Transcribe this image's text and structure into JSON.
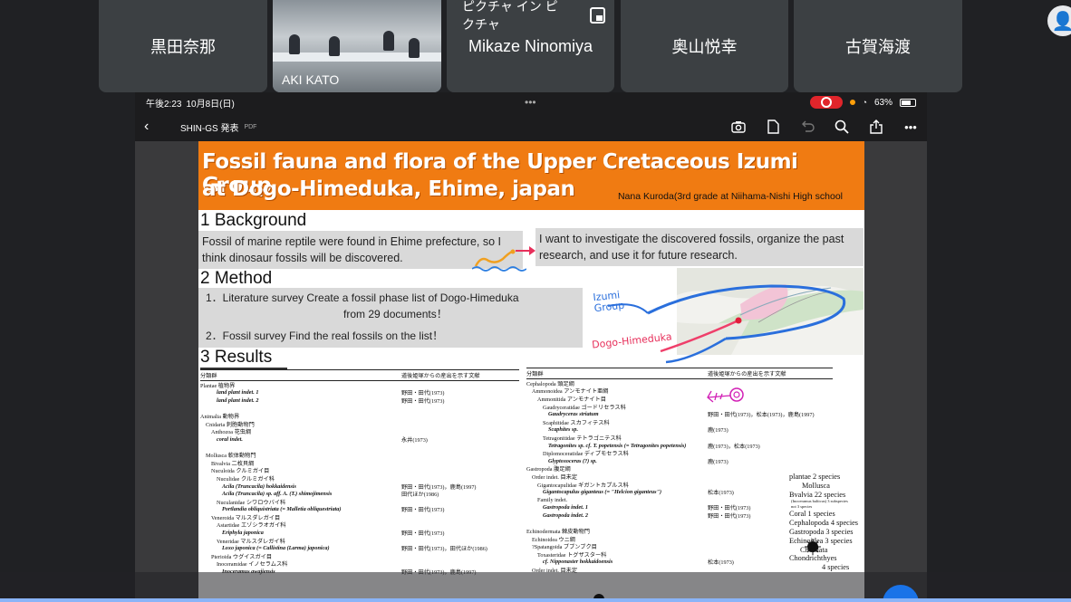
{
  "participants": [
    {
      "name": "黒田奈那"
    },
    {
      "name": "AKI KATO"
    },
    {
      "name": "Mikaze Ninomiya"
    },
    {
      "name": "奥山悦幸"
    },
    {
      "name": "古賀海渡"
    }
  ],
  "pip_label": "ピクチャ イン ピクチャ",
  "ipad": {
    "time": "午後2:23",
    "date": "10月8日(日)",
    "battery": "63%",
    "doc_title": "SHIN-GS 発表",
    "doc_type": "PDF"
  },
  "poster": {
    "title_line1": "Fossil fauna and flora of the Upper Cretaceous  Izumi Group",
    "title_line2": "at Dogo-Himeduka, Ehime, japan",
    "author": "Nana Kuroda(3rd grade at Niihama-Nishi High school",
    "background_title": "1  Background",
    "background_text1": "Fossil of  marine reptile were found  in Ehime prefecture, so I  think dinosaur fossils will be discovered.",
    "background_text2": "I want to investigate the discovered fossils, organize the past research, and use  it for future research.",
    "method_title": "2  Method",
    "method_step1a": "1．Literature survey      Create a fossil phase list of Dogo-Himeduka",
    "method_step1b": "from 29 documents！",
    "method_step2": "2．Fossil survey    Find  the real fossils  on the list！",
    "map_label_izumi": "Izumi Group",
    "map_label_dogo": "Dogo-Himeduka",
    "results_title": "3 Results",
    "table_header_col1": "分類群",
    "table_header_col2": "道後姫塚からの産出を示す文献",
    "left_table": [
      {
        "name": "Plantae  植物界",
        "ref": "",
        "b": false,
        "indent": 0
      },
      {
        "name": "land plant indet. 1",
        "ref": "野田・田代(1973)",
        "b": true,
        "indent": 3
      },
      {
        "name": "land plant indet. 2",
        "ref": "野田・田代(1973)",
        "b": true,
        "indent": 3
      },
      {
        "name": "",
        "ref": "",
        "b": false,
        "indent": 0
      },
      {
        "name": "Animalia  動物界",
        "ref": "",
        "b": false,
        "indent": 0
      },
      {
        "name": "Cnidaria  刺胞動物門",
        "ref": "",
        "b": false,
        "indent": 1
      },
      {
        "name": "Anthozoa  花虫綱",
        "ref": "",
        "b": false,
        "indent": 2
      },
      {
        "name": "coral indet.",
        "ref": "永井(1973)",
        "b": true,
        "indent": 3
      },
      {
        "name": "",
        "ref": "",
        "b": false,
        "indent": 0
      },
      {
        "name": "Mollusca  軟体動物門",
        "ref": "",
        "b": false,
        "indent": 1
      },
      {
        "name": "Bivalvia  二枚貝綱",
        "ref": "",
        "b": false,
        "indent": 2
      },
      {
        "name": "Nuculoida  クルミガイ目",
        "ref": "",
        "b": false,
        "indent": 2
      },
      {
        "name": "Nuculidae  クルミガイ科",
        "ref": "",
        "b": false,
        "indent": 3
      },
      {
        "name": "Acila (Truncacila) hokkaidensis",
        "ref": "野田・田代(1973)，鹿島(1997)",
        "b": true,
        "indent": 4
      },
      {
        "name": "Acila (Truncacila) sp. aff. A. (T.) shimojimensis",
        "ref": "田代ほか(1986)",
        "b": true,
        "indent": 4
      },
      {
        "name": "Nuculanidae  シワロウバイ科",
        "ref": "",
        "b": false,
        "indent": 3
      },
      {
        "name": "Portlandia obliquistriata (= Malletia obliquestriata)",
        "ref": "野田・田代(1973)",
        "b": true,
        "indent": 4
      },
      {
        "name": "Veneroida  マルスダレガイ目",
        "ref": "",
        "b": false,
        "indent": 2
      },
      {
        "name": "Astartidae  エゾシラオガイ科",
        "ref": "",
        "b": false,
        "indent": 3
      },
      {
        "name": "Eriphyla japonica",
        "ref": "野田・田代(1973)",
        "b": true,
        "indent": 4
      },
      {
        "name": "Veneridae  マルスダレガイ科",
        "ref": "",
        "b": false,
        "indent": 3
      },
      {
        "name": "Loxo japonica (= Callistina (Larma) japonica)",
        "ref": "野田・田代(1973)，田代ほか(1986)",
        "b": true,
        "indent": 4
      },
      {
        "name": "Pterioida  ウグイスガイ目",
        "ref": "",
        "b": false,
        "indent": 2
      },
      {
        "name": "Inoceramidae  イノセラムス科",
        "ref": "",
        "b": false,
        "indent": 3
      },
      {
        "name": "Inoceramus awajiensis",
        "ref": "野田・田代(1973)，鹿島(1997)",
        "b": true,
        "indent": 4
      }
    ],
    "right_table": [
      {
        "name": "Cephalopoda  頭足綱",
        "ref": "",
        "b": false,
        "indent": 0
      },
      {
        "name": "Ammonoidea  アンモナイト亜綱",
        "ref": "",
        "b": false,
        "indent": 1
      },
      {
        "name": "Ammonitida  アンモナイト目",
        "ref": "",
        "b": false,
        "indent": 2
      },
      {
        "name": "Gaudryceratidae  ゴードリセラス科",
        "ref": "",
        "b": false,
        "indent": 3
      },
      {
        "name": "Gaudryceras striatum",
        "ref": "野田・田代(1973)，松本(1973)，鹿島(1997)",
        "b": true,
        "indent": 4
      },
      {
        "name": "Scaphitidae  スカフィテス科",
        "ref": "",
        "b": false,
        "indent": 3
      },
      {
        "name": "Scaphites sp.",
        "ref": "鹿(1973)",
        "b": true,
        "indent": 4
      },
      {
        "name": "Tetragonitidae  テトラゴニテス科",
        "ref": "",
        "b": false,
        "indent": 3
      },
      {
        "name": "Tetragonites sp. cf. T. popetensis (= Tetragonites popetensis)",
        "ref": "鹿(1973)，松本(1973)",
        "b": true,
        "indent": 4
      },
      {
        "name": "Diplomoceratidae  ディプモセラス科",
        "ref": "",
        "b": false,
        "indent": 3
      },
      {
        "name": "Glyptoxoceras (?) sp.",
        "ref": "鹿(1973)",
        "b": true,
        "indent": 4
      },
      {
        "name": "Gastropoda  腹足綱",
        "ref": "",
        "b": false,
        "indent": 0
      },
      {
        "name": "Order indet.  目未定",
        "ref": "",
        "b": false,
        "indent": 1
      },
      {
        "name": "Gigantocapulidae  ギガントカプルス科",
        "ref": "",
        "b": false,
        "indent": 2
      },
      {
        "name": "Gigantocapulus giganteus (= \"Helcion giganteus\")",
        "ref": "松本(1973)",
        "b": true,
        "indent": 3
      },
      {
        "name": "Family indet.",
        "ref": "",
        "b": false,
        "indent": 2
      },
      {
        "name": "Gastropoda indet. 1",
        "ref": "野田・田代(1973)",
        "b": true,
        "indent": 3
      },
      {
        "name": "Gastropoda indet. 2",
        "ref": "野田・田代(1973)",
        "b": true,
        "indent": 3
      },
      {
        "name": "",
        "ref": "",
        "b": false,
        "indent": 0
      },
      {
        "name": "Echinodermata  棘皮動物門",
        "ref": "",
        "b": false,
        "indent": 0
      },
      {
        "name": "Echinoidea  ウニ綱",
        "ref": "",
        "b": false,
        "indent": 1
      },
      {
        "name": "?Spatangoida  ブブンブク目",
        "ref": "",
        "b": false,
        "indent": 1
      },
      {
        "name": "Toxasteridae  トグザスター科",
        "ref": "",
        "b": false,
        "indent": 2
      },
      {
        "name": "cf. Nipponaster hokkaidoensis",
        "ref": "松本(1973)",
        "b": true,
        "indent": 3
      },
      {
        "name": "Order indet.  目未定",
        "ref": "",
        "b": false,
        "indent": 1
      }
    ],
    "summary": [
      {
        "text": "plantae 2 species",
        "small": false,
        "indent": 0
      },
      {
        "text": "Mollusca",
        "small": false,
        "indent": 14
      },
      {
        "text": "Bvalvia 22 species",
        "small": false,
        "indent": 0
      },
      {
        "text": "(Inoceramus balticus) 3 subspecies",
        "small": true,
        "indent": 2
      },
      {
        "text": "not 3 species",
        "small": true,
        "indent": 2
      },
      {
        "text": "Coral 1 species",
        "small": false,
        "indent": 0
      },
      {
        "text": "Cephalopoda 4 species",
        "small": false,
        "indent": 0
      },
      {
        "text": "Gastropoda 3 species",
        "small": false,
        "indent": 0
      },
      {
        "text": "Echinoidea 3 species",
        "small": false,
        "indent": 0
      },
      {
        "text": "Chordata",
        "small": false,
        "indent": 12
      },
      {
        "text": "Chondrichthyes",
        "small": false,
        "indent": 0
      },
      {
        "text": "4 species",
        "small": false,
        "indent": 36
      }
    ]
  }
}
